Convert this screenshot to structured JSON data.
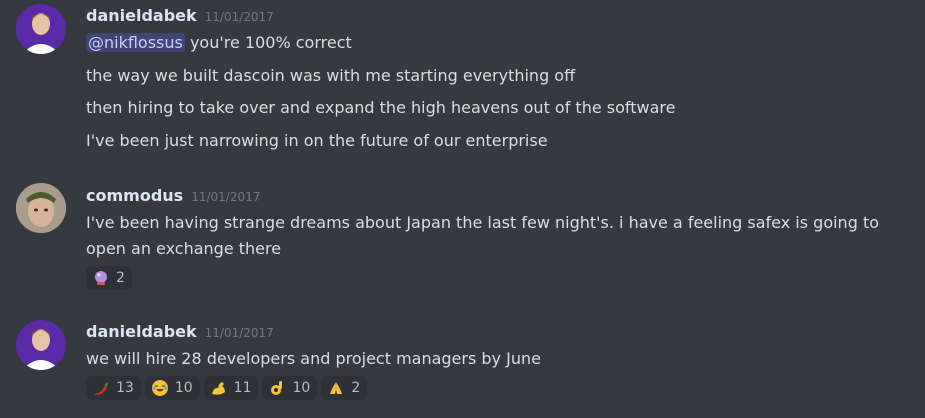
{
  "messages": [
    {
      "author": "danieldabek",
      "timestamp": "11/01/2017",
      "lines": [
        {
          "mention": "@nikflossus",
          "text": " you're 100% correct"
        },
        {
          "text": "the way we built dascoin was with me starting everything off"
        },
        {
          "text": "then hiring to take over and expand the high heavens out of the software"
        },
        {
          "text": "I've been just narrowing in on the future of our enterprise"
        }
      ],
      "reactions": []
    },
    {
      "author": "commodus",
      "timestamp": "11/01/2017",
      "lines": [
        {
          "text": "I've been having strange dreams about Japan the last few night's.   i have a feeling safex is going to"
        },
        {
          "text": "open an exchange there"
        }
      ],
      "reactions": [
        {
          "emoji": "crystal-ball-icon",
          "count": "2"
        }
      ]
    },
    {
      "author": "danieldabek",
      "timestamp": "11/01/2017",
      "lines": [
        {
          "text": "we will hire 28 developers and project managers by June"
        }
      ],
      "reactions": [
        {
          "emoji": "chili-pepper-icon",
          "count": "13"
        },
        {
          "emoji": "joy-face-icon",
          "count": "10"
        },
        {
          "emoji": "flexed-biceps-icon",
          "count": "11"
        },
        {
          "emoji": "ok-hand-icon",
          "count": "10"
        },
        {
          "emoji": "folded-hands-icon",
          "count": "2"
        }
      ]
    }
  ]
}
